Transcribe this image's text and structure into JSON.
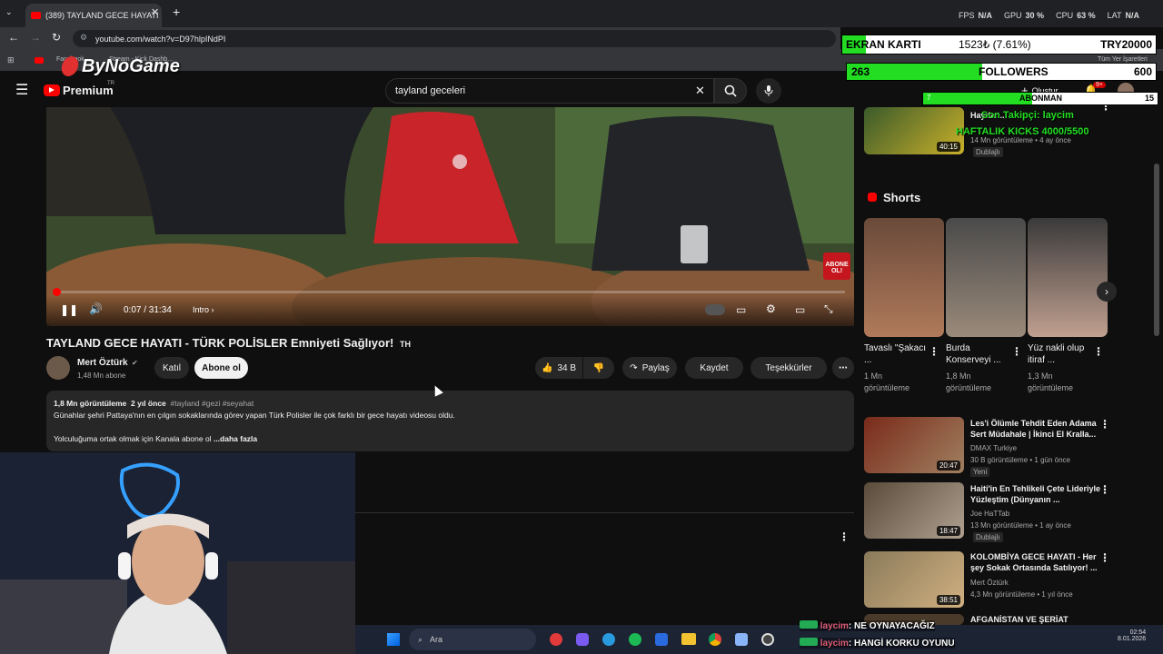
{
  "browser": {
    "tab_title": "(389) TAYLAND GECE HAYATI",
    "url": "youtube.com/watch?v=D97hlpINdPI",
    "bookmarks": [
      "Facebook",
      "Stream - Kick Dashb...",
      "Tüm Yer İşaretleri"
    ]
  },
  "stats_overlay": {
    "fps_label": "FPS",
    "fps": "N/A",
    "gpu_label": "GPU",
    "gpu": "30 %",
    "cpu_label": "CPU",
    "cpu": "63 %",
    "lat_label": "LAT",
    "lat": "N/A"
  },
  "brand_overlay": {
    "logo": "ByNoGame"
  },
  "goal_overlay": {
    "ekran_label": "EKRAN KARTI",
    "ekran_value": "1523₺ (7.61%)",
    "ekran_goal": "TRY20000",
    "ekran_fraction": 0.0761,
    "followers_current": "263",
    "followers_label": "FOLLOWERS",
    "followers_goal": "600",
    "followers_fraction": 0.438,
    "abone_current": "7",
    "abone_label": "ABONMAN",
    "abone_goal": "15",
    "abone_fraction": 0.467,
    "last_follower": "Son Takipçi: laycim",
    "kicks": "HAFTALIK KICKS 4000/5500"
  },
  "youtube": {
    "logo": "Premium",
    "logo_region": "TR",
    "search_value": "tayland geceleri",
    "create_label": "Oluştur",
    "notif_badge": "9+"
  },
  "player": {
    "time": "0:07 / 31:34",
    "chapter": "Intro",
    "progress_fraction": 0.004,
    "abone_sticker": "ABONE OL!"
  },
  "video": {
    "title": "TAYLAND GECE HAYATI - TÜRK POLİSLER Emniyeti Sağlıyor!",
    "title_flag": "TH",
    "channel": "Mert Öztürk",
    "subs": "1,48 Mn abone",
    "join": "Katıl",
    "subscribe": "Abone ol",
    "likes": "34 B",
    "share": "Paylaş",
    "save": "Kaydet",
    "thanks": "Teşekkürler"
  },
  "description": {
    "views": "1,8 Mn görüntüleme",
    "age": "2 yıl önce",
    "tags": "#tayland #gezi #seyahat",
    "line1": "Günahlar şehri Pattaya'nın en çılgın sokaklarında görev yapan Türk Polisler ile çok farklı bir gece hayatı videosu oldu.",
    "line2": "Yolculuğuma ortak olmak için Kanala abone ol",
    "more": "...daha fazla"
  },
  "sidebar": {
    "top_item": {
      "title": "Haydar...",
      "meta": "14 Mn görüntüleme • 4 ay önce",
      "duration": "40:15",
      "badge": "Dublajlı"
    },
    "shorts_heading": "Shorts",
    "shorts": [
      {
        "title": "Tavaslı \"Şakacı ...",
        "views": "1 Mn görüntüleme"
      },
      {
        "title": "Burda Konserveyi ...",
        "views": "1,8 Mn görüntüleme"
      },
      {
        "title": "Yüz nakli olup itiraf ...",
        "views": "1,3 Mn görüntüleme"
      }
    ],
    "videos": [
      {
        "title": "Les'i Ölümle Tehdit Eden Adama Sert Müdahale | İkinci El Kralla...",
        "channel": "DMAX Turkiye",
        "meta": "30 B görüntüleme • 1 gün önce",
        "badge": "Yeni",
        "duration": "20:47"
      },
      {
        "title": "Haiti'in En Tehlikeli Çete Lideriyle Yüzleştim (Dünyanın ...",
        "channel": "Joe HaTTab",
        "meta": "13 Mn görüntüleme • 1 ay önce",
        "badge": "Dublajlı",
        "duration": "18:47"
      },
      {
        "title": "KOLOMBİYA GECE HAYATI - Her şey Sokak Ortasında Satılıyor! ...",
        "channel": "Mert Öztürk",
        "meta": "4,3 Mn görüntüleme • 1 yıl önce",
        "badge": "",
        "duration": "38:51"
      },
      {
        "title": "AFGANİSTAN VE ŞERİAT",
        "channel": "",
        "meta": "",
        "badge": "",
        "duration": ""
      }
    ]
  },
  "chat": [
    {
      "user": "laycim",
      "text": ": NE OYNAYACAĞIZ"
    },
    {
      "user": "laycim",
      "text": ": HANGİ KORKU OYUNU"
    }
  ],
  "taskbar": {
    "search": "Ara",
    "time": "02:54",
    "date": "8.01.2026"
  },
  "colors": {
    "yt_red": "#ff0000",
    "goal_green": "#22dd22",
    "bg": "#0f0f0f"
  }
}
